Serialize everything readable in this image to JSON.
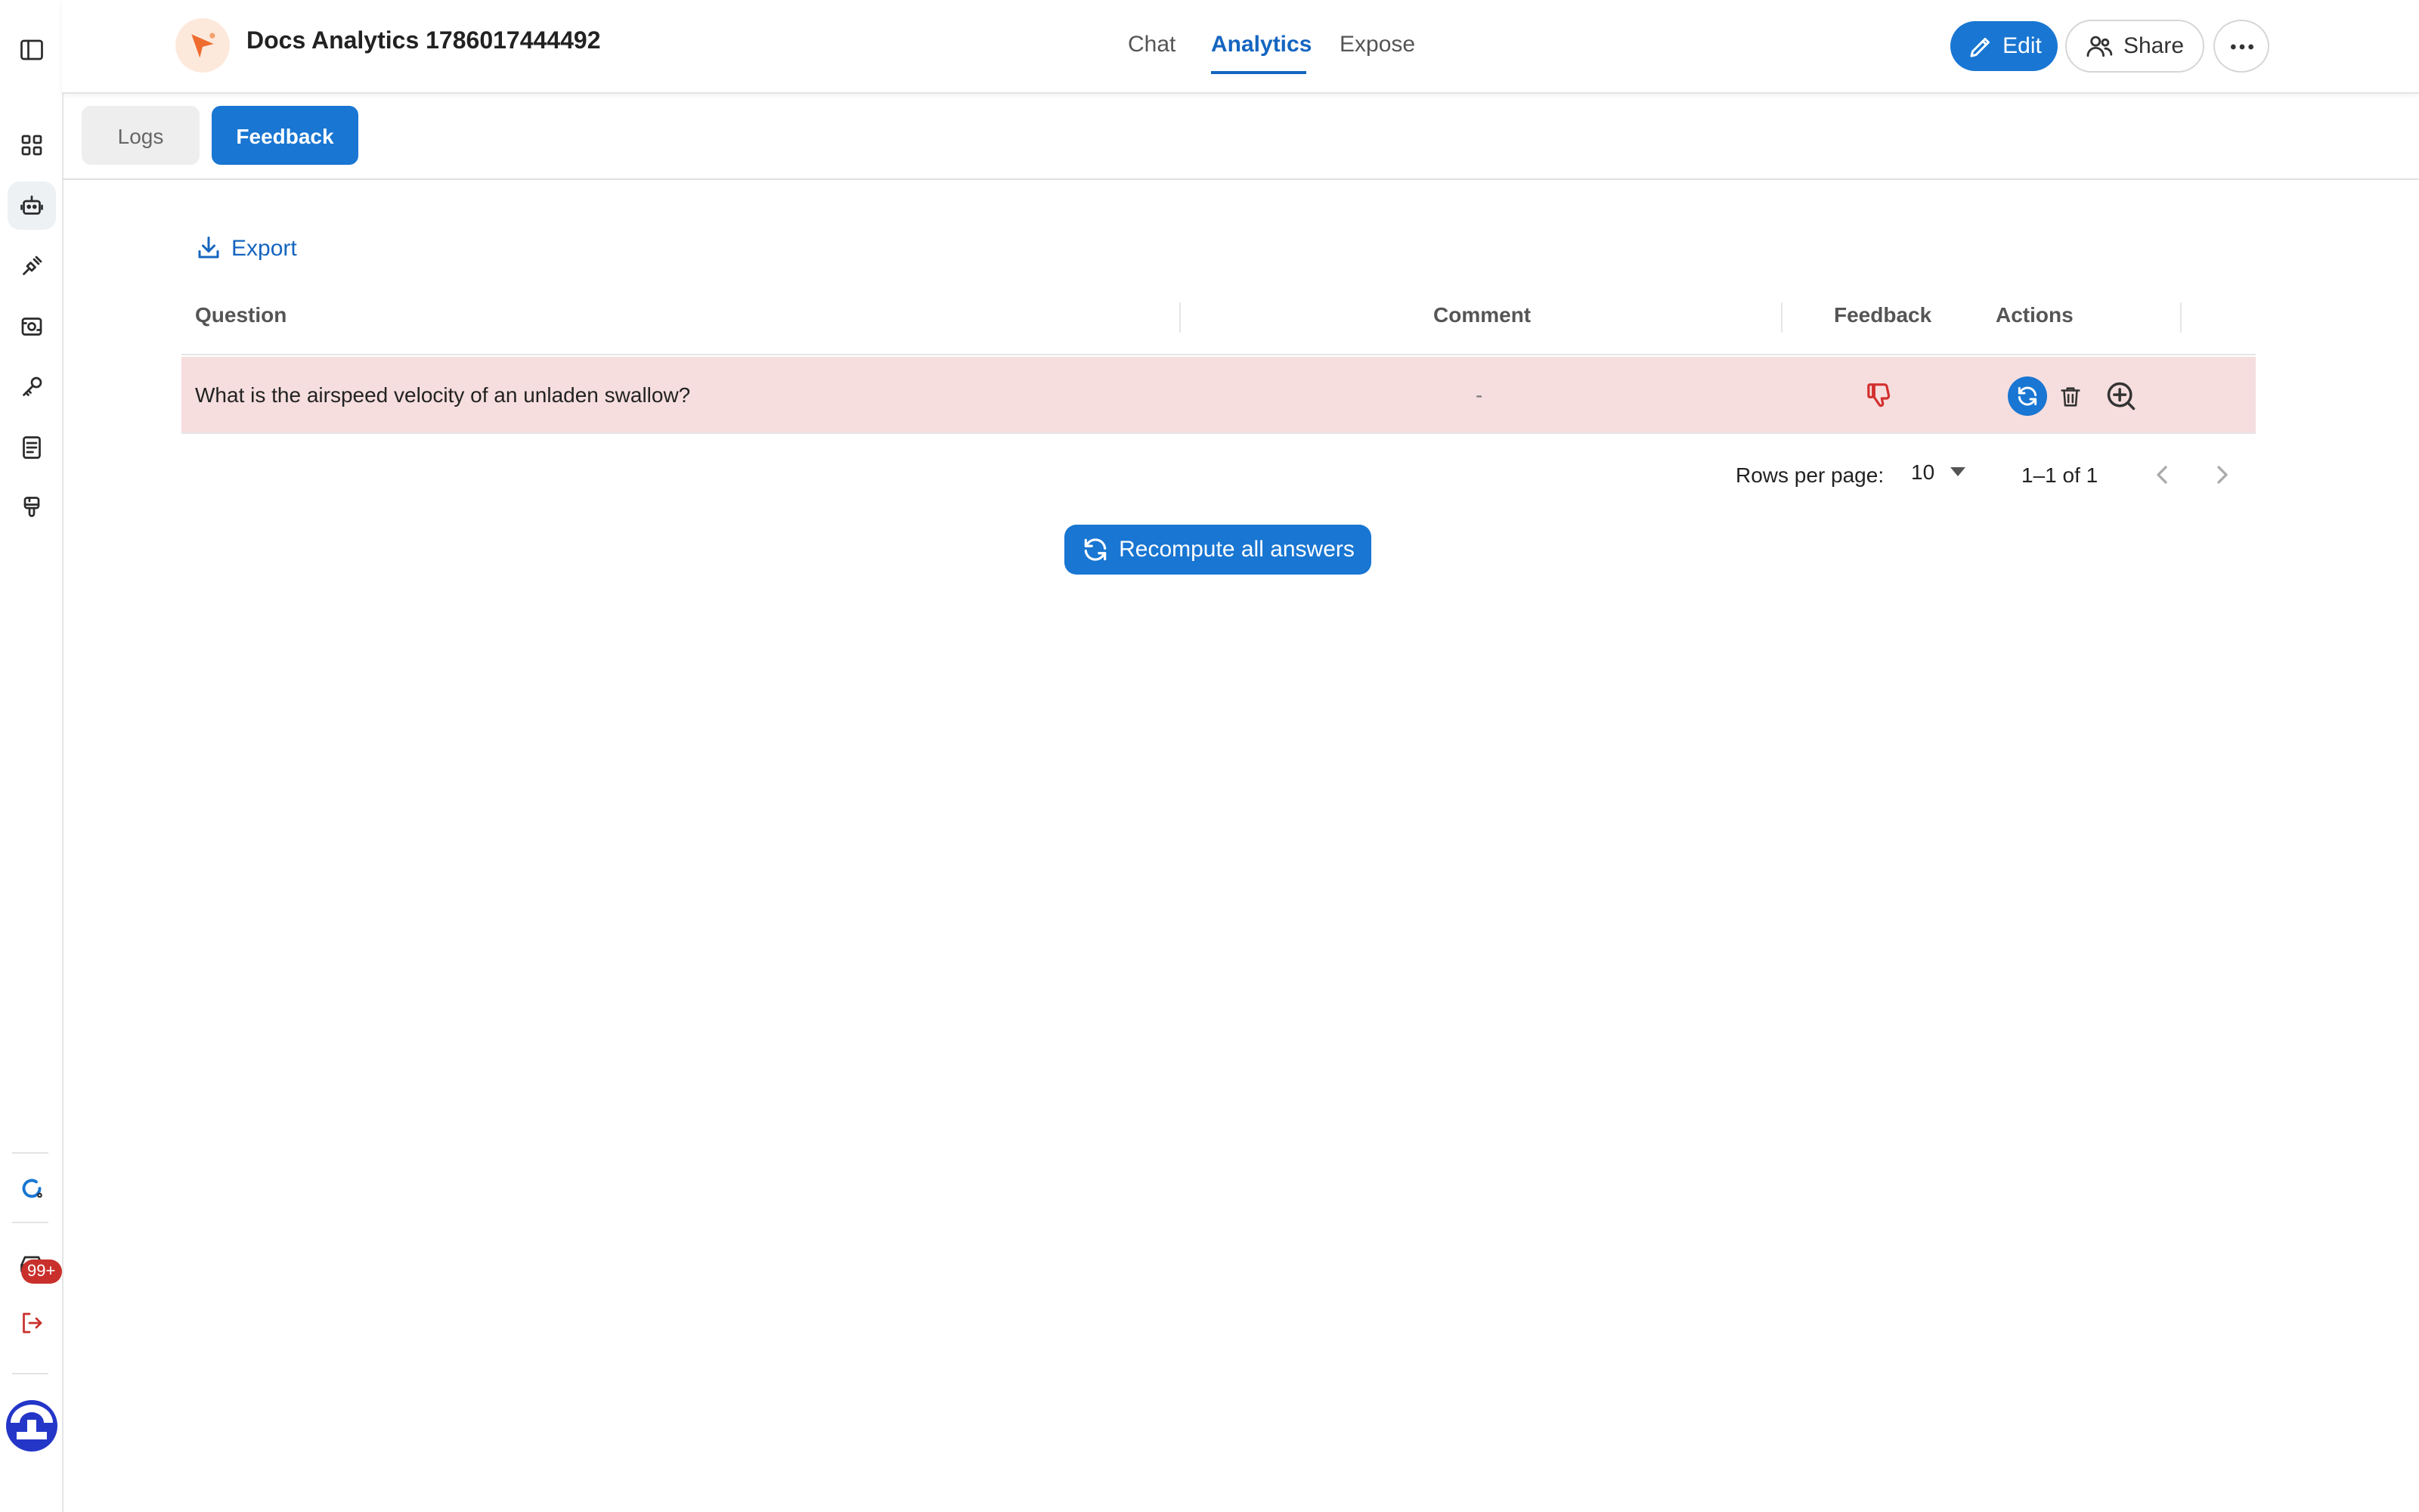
{
  "header": {
    "app_title": "Docs Analytics 1786017444492",
    "nav": [
      {
        "label": "Chat",
        "active": false
      },
      {
        "label": "Analytics",
        "active": true
      },
      {
        "label": "Expose",
        "active": false
      }
    ],
    "edit_label": "Edit",
    "share_label": "Share"
  },
  "subtabs": {
    "logs": "Logs",
    "feedback": "Feedback"
  },
  "export_label": "Export",
  "table": {
    "columns": [
      "Question",
      "Comment",
      "Feedback",
      "Actions"
    ],
    "rows": [
      {
        "question": "What is the airspeed velocity of an unladen swallow?",
        "comment": "-",
        "feedback": "thumb-down-icon"
      }
    ]
  },
  "pagination": {
    "rows_per_page_label": "Rows per page:",
    "rows_per_page_value": "10",
    "range": "1–1 of 1"
  },
  "recompute_label": "Recompute all answers",
  "sidebar": {
    "notifications_badge": "99+"
  },
  "colors": {
    "accent": "#1976d2",
    "row_highlight": "#f6dede",
    "negative": "#d32f2f"
  }
}
